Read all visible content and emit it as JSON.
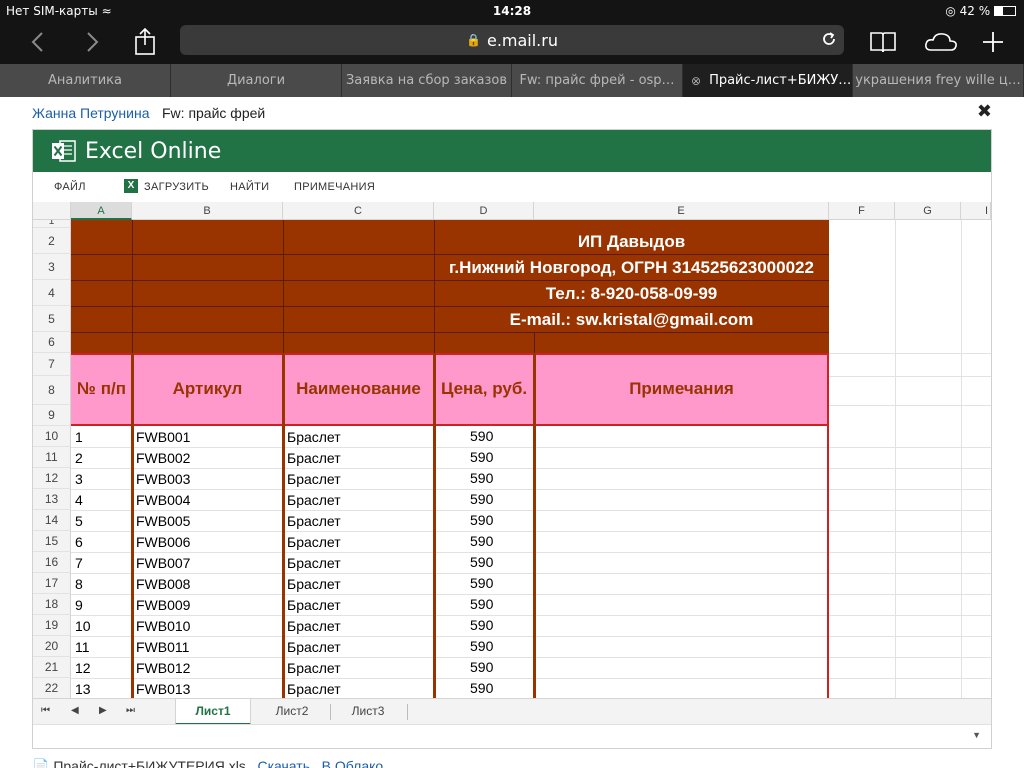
{
  "statusbar": {
    "carrier": "Нет SIM-карты",
    "time": "14:28",
    "battery": "42 %"
  },
  "browser": {
    "url": "e.mail.ru",
    "tabs": [
      {
        "label": "Аналитика",
        "active": false
      },
      {
        "label": "Диалоги",
        "active": false
      },
      {
        "label": "Заявка на сбор заказов",
        "active": false
      },
      {
        "label": "Fw: прайс фрей - osp…",
        "active": false
      },
      {
        "label": "Прайс-лист+БИЖУ…",
        "active": true
      },
      {
        "label": "украшения frey wille ц…",
        "active": false
      }
    ]
  },
  "mail": {
    "sender": "Жанна Петрунина",
    "subject": "Fw: прайс фрей"
  },
  "excel": {
    "app_title": "Excel Online",
    "menu": {
      "file": "ФАЙЛ",
      "download": "ЗАГРУЗИТЬ",
      "find": "НАЙТИ",
      "comments": "ПРИМЕЧАНИЯ"
    },
    "columns": [
      "A",
      "B",
      "C",
      "D",
      "E",
      "F",
      "G",
      "I"
    ],
    "rows": [
      "1",
      "2",
      "3",
      "4",
      "5",
      "6",
      "7",
      "8",
      "9",
      "10",
      "11",
      "12",
      "13",
      "14",
      "15",
      "16",
      "17",
      "18",
      "19",
      "20",
      "21",
      "22"
    ],
    "header": {
      "line1": "ИП Давыдов",
      "line2": "г.Нижний Новгород, ОГРН 314525623000022",
      "line3": "Тел.: 8-920-058-09-99",
      "line4": "E-mail.: sw.kristal@gmail.com"
    },
    "table_headers": {
      "num": "№ п/п",
      "article": "Артикул",
      "name": "Наименование",
      "price": "Цена, руб.",
      "notes": "Примечания"
    },
    "items": [
      {
        "num": "1",
        "article": "FWB001",
        "name": "Браслет",
        "price": "590"
      },
      {
        "num": "2",
        "article": "FWB002",
        "name": "Браслет",
        "price": "590"
      },
      {
        "num": "3",
        "article": "FWB003",
        "name": "Браслет",
        "price": "590"
      },
      {
        "num": "4",
        "article": "FWB004",
        "name": "Браслет",
        "price": "590"
      },
      {
        "num": "5",
        "article": "FWB005",
        "name": "Браслет",
        "price": "590"
      },
      {
        "num": "6",
        "article": "FWB006",
        "name": "Браслет",
        "price": "590"
      },
      {
        "num": "7",
        "article": "FWB007",
        "name": "Браслет",
        "price": "590"
      },
      {
        "num": "8",
        "article": "FWB008",
        "name": "Браслет",
        "price": "590"
      },
      {
        "num": "9",
        "article": "FWB009",
        "name": "Браслет",
        "price": "590"
      },
      {
        "num": "10",
        "article": "FWB010",
        "name": "Браслет",
        "price": "590"
      },
      {
        "num": "11",
        "article": "FWB011",
        "name": "Браслет",
        "price": "590"
      },
      {
        "num": "12",
        "article": "FWB012",
        "name": "Браслет",
        "price": "590"
      },
      {
        "num": "13",
        "article": "FWB013",
        "name": "Браслет",
        "price": "590"
      }
    ],
    "sheets": [
      {
        "label": "Лист1",
        "active": true
      },
      {
        "label": "Лист2",
        "active": false
      },
      {
        "label": "Лист3",
        "active": false
      }
    ]
  },
  "footer": {
    "filename": "Прайс-лист+БИЖУТЕРИЯ.xls",
    "link1": "Скачать",
    "link2": "В Облако"
  },
  "colors": {
    "excel_green": "#217346",
    "header_brown": "#993300",
    "header_pink": "#ff99cc",
    "border_red": "#d02020"
  }
}
